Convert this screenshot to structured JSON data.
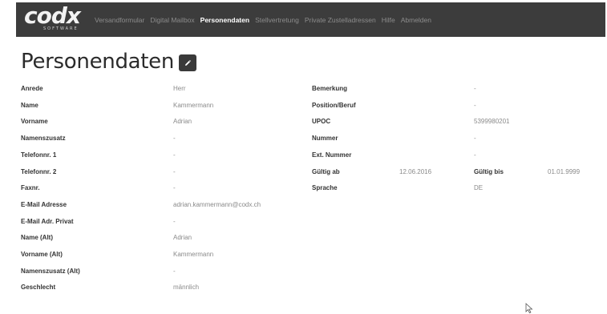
{
  "logo": {
    "main": "codx",
    "sub": "SOFTWARE"
  },
  "nav": [
    {
      "label": "Versandformular",
      "active": false
    },
    {
      "label": "Digital Mailbox",
      "active": false
    },
    {
      "label": "Personendaten",
      "active": true
    },
    {
      "label": "Stellvertretung",
      "active": false
    },
    {
      "label": "Private Zustelladressen",
      "active": false
    },
    {
      "label": "Hilfe",
      "active": false
    },
    {
      "label": "Abmelden",
      "active": false
    }
  ],
  "page_title": "Personendaten",
  "left_fields": [
    {
      "label": "Anrede",
      "value": "Herr"
    },
    {
      "label": "Name",
      "value": "Kammermann"
    },
    {
      "label": "Vorname",
      "value": "Adrian"
    },
    {
      "label": "Namenszusatz",
      "value": "-"
    },
    {
      "label": "Telefonnr. 1",
      "value": "-"
    },
    {
      "label": "Telefonnr. 2",
      "value": "-"
    },
    {
      "label": "Faxnr.",
      "value": "-"
    },
    {
      "label": "E-Mail Adresse",
      "value": "adrian.kammermann@codx.ch"
    },
    {
      "label": "E-Mail Adr. Privat",
      "value": "-"
    },
    {
      "label": "Name (Alt)",
      "value": "Adrian"
    },
    {
      "label": "Vorname (Alt)",
      "value": "Kammermann"
    },
    {
      "label": "Namenszusatz (Alt)",
      "value": "-"
    },
    {
      "label": "Geschlecht",
      "value": "männlich"
    }
  ],
  "right_fields": [
    {
      "label": "Bemerkung",
      "value": "-"
    },
    {
      "label": "Position/Beruf",
      "value": "-"
    },
    {
      "label": "UPOC",
      "value": "5399980201"
    },
    {
      "label": "Nummer",
      "value": "-"
    },
    {
      "label": "Ext. Nummer",
      "value": "-"
    },
    {
      "label": "Gültig ab",
      "value": "12.06.2016",
      "label2": "Gültig bis",
      "value2": "01.01.9999"
    },
    {
      "label": "Sprache",
      "value": "DE"
    }
  ]
}
